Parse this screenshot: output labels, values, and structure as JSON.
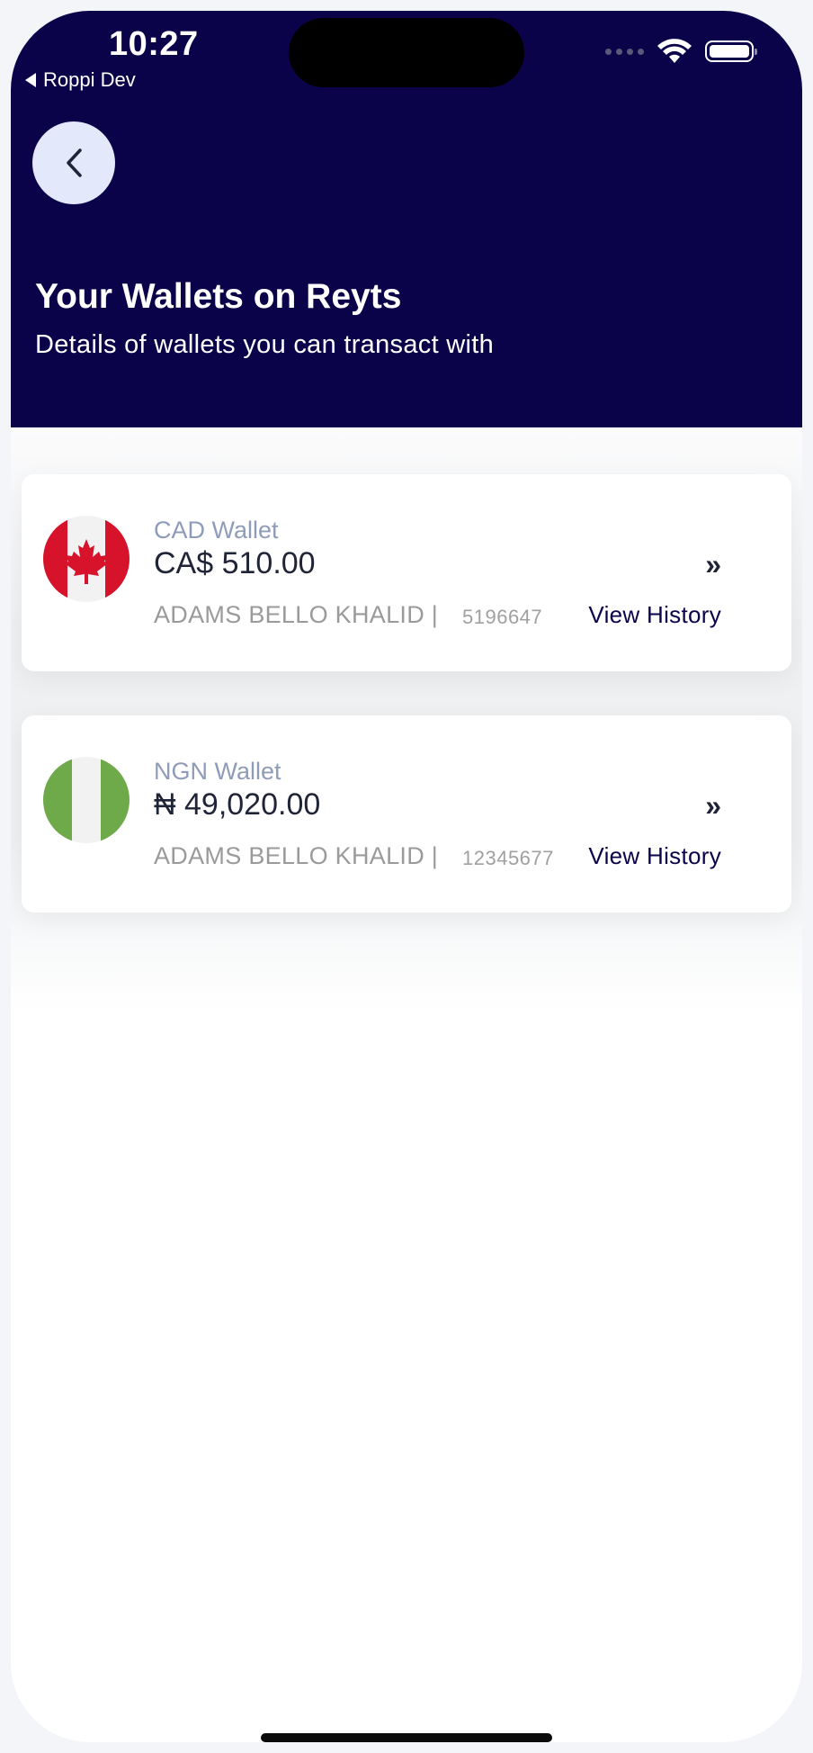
{
  "status_bar": {
    "time": "10:27",
    "back_app": "Roppi Dev"
  },
  "header": {
    "title": "Your Wallets on Reyts",
    "subtitle": "Details of wallets you can transact with"
  },
  "wallets": [
    {
      "name": "CAD Wallet",
      "balance": "CA$ 510.00",
      "holder": "ADAMS BELLO KHALID |",
      "account": "5196647",
      "action": "View History",
      "flag": "canada-flag-icon"
    },
    {
      "name": "NGN Wallet",
      "balance": "₦ 49,020.00",
      "holder": "ADAMS BELLO KHALID |",
      "account": "12345677",
      "action": "View History",
      "flag": "nigeria-flag-icon"
    }
  ],
  "colors": {
    "header_bg": "#0b0349",
    "back_button_bg": "#e3e8fb",
    "canada_red": "#d7132c",
    "nigeria_green": "#6ea94a"
  }
}
